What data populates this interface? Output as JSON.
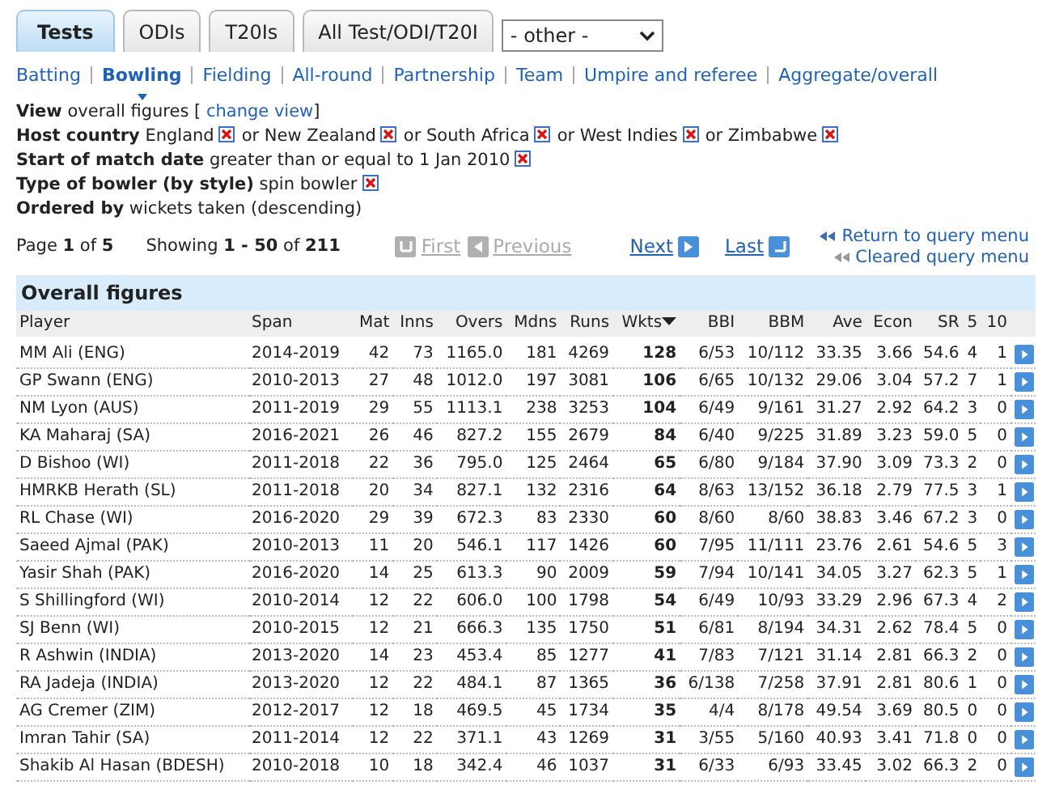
{
  "tabs": [
    {
      "label": "Tests",
      "selected": true
    },
    {
      "label": "ODIs",
      "selected": false
    },
    {
      "label": "T20Is",
      "selected": false
    },
    {
      "label": "All Test/ODI/T20I",
      "selected": false
    }
  ],
  "format_select": {
    "value": "- other -"
  },
  "nav": [
    {
      "label": "Batting",
      "selected": false
    },
    {
      "label": "Bowling",
      "selected": true
    },
    {
      "label": "Fielding",
      "selected": false
    },
    {
      "label": "All-round",
      "selected": false
    },
    {
      "label": "Partnership",
      "selected": false
    },
    {
      "label": "Team",
      "selected": false
    },
    {
      "label": "Umpire and referee",
      "selected": false
    },
    {
      "label": "Aggregate/overall",
      "selected": false
    }
  ],
  "view": {
    "label": "View",
    "value": "overall figures",
    "bracket_open": "[",
    "link": "change view",
    "bracket_close": "]"
  },
  "query": [
    {
      "label": "Host country",
      "values": [
        {
          "text": "England",
          "removable": true
        },
        {
          "text": "or New Zealand",
          "removable": true
        },
        {
          "text": "or South Africa",
          "removable": true
        },
        {
          "text": "or West Indies",
          "removable": true
        },
        {
          "text": "or Zimbabwe",
          "removable": true
        }
      ]
    },
    {
      "label": "Start of match date",
      "values": [
        {
          "text": "greater than or equal to 1 Jan 2010",
          "removable": true
        }
      ]
    },
    {
      "label": "Type of bowler (by style)",
      "values": [
        {
          "text": "spin bowler",
          "removable": true
        }
      ]
    },
    {
      "label": "Ordered by",
      "values": [
        {
          "text": "wickets taken (descending)",
          "removable": false
        }
      ]
    }
  ],
  "pager": {
    "page": "Page **1** of **5**",
    "showing": "Showing **1 - 50** of **211**",
    "buttons": [
      {
        "label": "First",
        "kind": "first",
        "disabled": true
      },
      {
        "label": "Previous",
        "kind": "previous",
        "disabled": true
      },
      {
        "label": "Next",
        "kind": "next",
        "disabled": false
      },
      {
        "label": "Last",
        "kind": "last",
        "disabled": false
      }
    ],
    "menu_links": [
      {
        "label": "Return to query menu",
        "kind": "return"
      },
      {
        "label": "Cleared query menu",
        "kind": "cleared"
      }
    ]
  },
  "table": {
    "caption": "Overall figures",
    "columns": [
      {
        "label": "Player",
        "sorted": false
      },
      {
        "label": "Span",
        "sorted": false
      },
      {
        "label": "Mat",
        "sorted": false
      },
      {
        "label": "Inns",
        "sorted": false
      },
      {
        "label": "Overs",
        "sorted": false
      },
      {
        "label": "Mdns",
        "sorted": false
      },
      {
        "label": "Runs",
        "sorted": false
      },
      {
        "label": "Wkts",
        "sorted": true
      },
      {
        "label": "BBI",
        "sorted": false
      },
      {
        "label": "BBM",
        "sorted": false
      },
      {
        "label": "Ave",
        "sorted": false
      },
      {
        "label": "Econ",
        "sorted": false
      },
      {
        "label": "SR",
        "sorted": false
      },
      {
        "label": "5",
        "sorted": false
      },
      {
        "label": "10",
        "sorted": false
      }
    ],
    "rows": [
      [
        "MM Ali (ENG)",
        "2014-2019",
        "42",
        "73",
        "1165.0",
        "181",
        "4269",
        "128",
        "6/53",
        "10/112",
        "33.35",
        "3.66",
        "54.6",
        "4",
        "1"
      ],
      [
        "GP Swann (ENG)",
        "2010-2013",
        "27",
        "48",
        "1012.0",
        "197",
        "3081",
        "106",
        "6/65",
        "10/132",
        "29.06",
        "3.04",
        "57.2",
        "7",
        "1"
      ],
      [
        "NM Lyon (AUS)",
        "2011-2019",
        "29",
        "55",
        "1113.1",
        "238",
        "3253",
        "104",
        "6/49",
        "9/161",
        "31.27",
        "2.92",
        "64.2",
        "3",
        "0"
      ],
      [
        "KA Maharaj (SA)",
        "2016-2021",
        "26",
        "46",
        "827.2",
        "155",
        "2679",
        "84",
        "6/40",
        "9/225",
        "31.89",
        "3.23",
        "59.0",
        "5",
        "0"
      ],
      [
        "D Bishoo (WI)",
        "2011-2018",
        "22",
        "36",
        "795.0",
        "125",
        "2464",
        "65",
        "6/80",
        "9/184",
        "37.90",
        "3.09",
        "73.3",
        "2",
        "0"
      ],
      [
        "HMRKB Herath (SL)",
        "2011-2018",
        "20",
        "34",
        "827.1",
        "132",
        "2316",
        "64",
        "8/63",
        "13/152",
        "36.18",
        "2.79",
        "77.5",
        "3",
        "1"
      ],
      [
        "RL Chase (WI)",
        "2016-2020",
        "29",
        "39",
        "672.3",
        "83",
        "2330",
        "60",
        "8/60",
        "8/60",
        "38.83",
        "3.46",
        "67.2",
        "3",
        "0"
      ],
      [
        "Saeed Ajmal (PAK)",
        "2010-2013",
        "11",
        "20",
        "546.1",
        "117",
        "1426",
        "60",
        "7/95",
        "11/111",
        "23.76",
        "2.61",
        "54.6",
        "5",
        "3"
      ],
      [
        "Yasir Shah (PAK)",
        "2016-2020",
        "14",
        "25",
        "613.3",
        "90",
        "2009",
        "59",
        "7/94",
        "10/141",
        "34.05",
        "3.27",
        "62.3",
        "5",
        "1"
      ],
      [
        "S Shillingford (WI)",
        "2010-2014",
        "12",
        "22",
        "606.0",
        "100",
        "1798",
        "54",
        "6/49",
        "10/93",
        "33.29",
        "2.96",
        "67.3",
        "4",
        "2"
      ],
      [
        "SJ Benn (WI)",
        "2010-2015",
        "12",
        "21",
        "666.3",
        "135",
        "1750",
        "51",
        "6/81",
        "8/194",
        "34.31",
        "2.62",
        "78.4",
        "5",
        "0"
      ],
      [
        "R Ashwin (INDIA)",
        "2013-2020",
        "14",
        "23",
        "453.4",
        "85",
        "1277",
        "41",
        "7/83",
        "7/121",
        "31.14",
        "2.81",
        "66.3",
        "2",
        "0"
      ],
      [
        "RA Jadeja (INDIA)",
        "2013-2020",
        "12",
        "22",
        "484.1",
        "87",
        "1365",
        "36",
        "6/138",
        "7/258",
        "37.91",
        "2.81",
        "80.6",
        "1",
        "0"
      ],
      [
        "AG Cremer (ZIM)",
        "2012-2017",
        "12",
        "18",
        "469.5",
        "45",
        "1734",
        "35",
        "4/4",
        "8/178",
        "49.54",
        "3.69",
        "80.5",
        "0",
        "0"
      ],
      [
        "Imran Tahir (SA)",
        "2011-2014",
        "12",
        "22",
        "371.1",
        "43",
        "1269",
        "31",
        "3/55",
        "5/160",
        "40.93",
        "3.41",
        "71.8",
        "0",
        "0"
      ],
      [
        "Shakib Al Hasan (BDESH)",
        "2010-2018",
        "10",
        "18",
        "342.4",
        "46",
        "1037",
        "31",
        "6/33",
        "6/93",
        "33.45",
        "3.02",
        "66.3",
        "2",
        "0"
      ]
    ]
  }
}
